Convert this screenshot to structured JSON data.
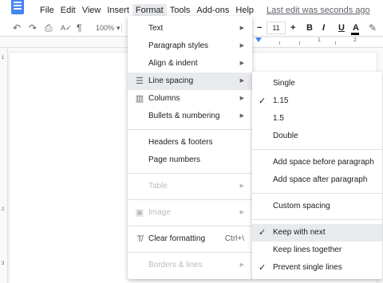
{
  "menubar": {
    "items": [
      "File",
      "Edit",
      "View",
      "Insert",
      "Format",
      "Tools",
      "Add-ons",
      "Help"
    ],
    "active": "Format",
    "last_edit": "Last edit was seconds ago"
  },
  "toolbar": {
    "zoom": "100%",
    "font_size": "11",
    "icons": [
      "undo-icon",
      "redo-icon",
      "print-icon",
      "spellcheck-icon",
      "paint-format-icon",
      "zoom-dropdown-icon",
      "font-size-decrease-icon",
      "font-size-increase-icon",
      "bold-icon",
      "italic-icon",
      "underline-icon",
      "text-color-icon",
      "highlight-icon"
    ],
    "bold": "B",
    "italic": "I",
    "underline": "U",
    "text_color": "A",
    "text_color_value": "#000000",
    "minus": "−",
    "plus": "+"
  },
  "ruler": {
    "numbers": [
      "1",
      "2"
    ],
    "left_numbers": [
      "1",
      "2",
      "3"
    ]
  },
  "format_menu": {
    "text": "Text",
    "paragraph_styles": "Paragraph styles",
    "align_indent": "Align & indent",
    "line_spacing": "Line spacing",
    "columns": "Columns",
    "bullets_numbering": "Bullets & numbering",
    "headers_footers": "Headers & footers",
    "page_numbers": "Page numbers",
    "table": "Table",
    "image": "Image",
    "clear_formatting": "Clear formatting",
    "clear_formatting_shortcut": "Ctrl+\\",
    "borders_lines": "Borders & lines"
  },
  "line_spacing_menu": {
    "single": "Single",
    "one_fifteen": "1.15",
    "one_five": "1.5",
    "double": "Double",
    "add_space_before": "Add space before paragraph",
    "add_space_after": "Add space after paragraph",
    "custom_spacing": "Custom spacing",
    "keep_with_next": "Keep with next",
    "keep_lines_together": "Keep lines together",
    "prevent_single_lines": "Prevent single lines",
    "checked": [
      "1.15",
      "Keep with next",
      "Prevent single lines"
    ]
  },
  "colors": {
    "accent": "#4285f4",
    "highlight": "#e8eaed",
    "disabled": "#b8bcc0"
  }
}
